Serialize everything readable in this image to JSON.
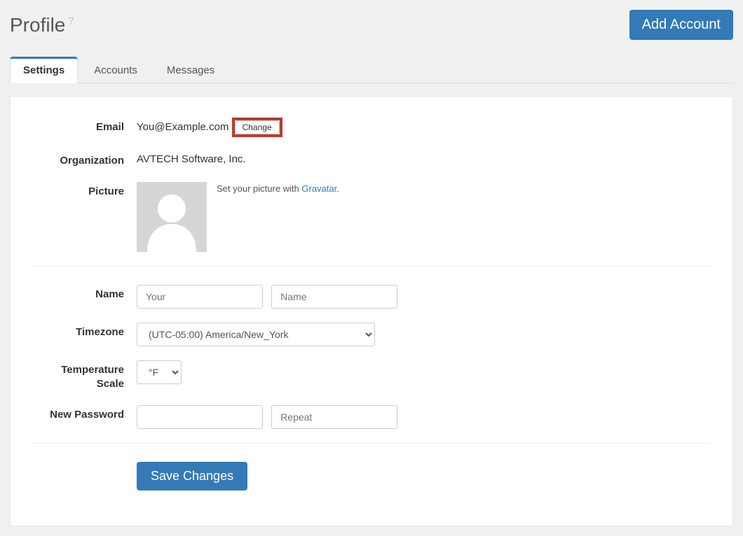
{
  "header": {
    "title": "Profile",
    "add_account_label": "Add Account"
  },
  "tabs": {
    "settings": "Settings",
    "accounts": "Accounts",
    "messages": "Messages"
  },
  "labels": {
    "email": "Email",
    "organization": "Organization",
    "picture": "Picture",
    "name": "Name",
    "timezone": "Timezone",
    "temperature_scale": "Temperature Scale",
    "new_password": "New Password"
  },
  "values": {
    "email": "You@Example.com",
    "change_label": "Change",
    "organization": "AVTECH Software, Inc.",
    "avatar_text_prefix": "Set your picture with ",
    "avatar_link_label": "Gravatar",
    "name_first_placeholder": "Your",
    "name_last_placeholder": "Name",
    "timezone_selected": "(UTC-05:00) America/New_York",
    "temperature_selected": "°F",
    "password_repeat_placeholder": "Repeat",
    "save_label": "Save Changes"
  }
}
